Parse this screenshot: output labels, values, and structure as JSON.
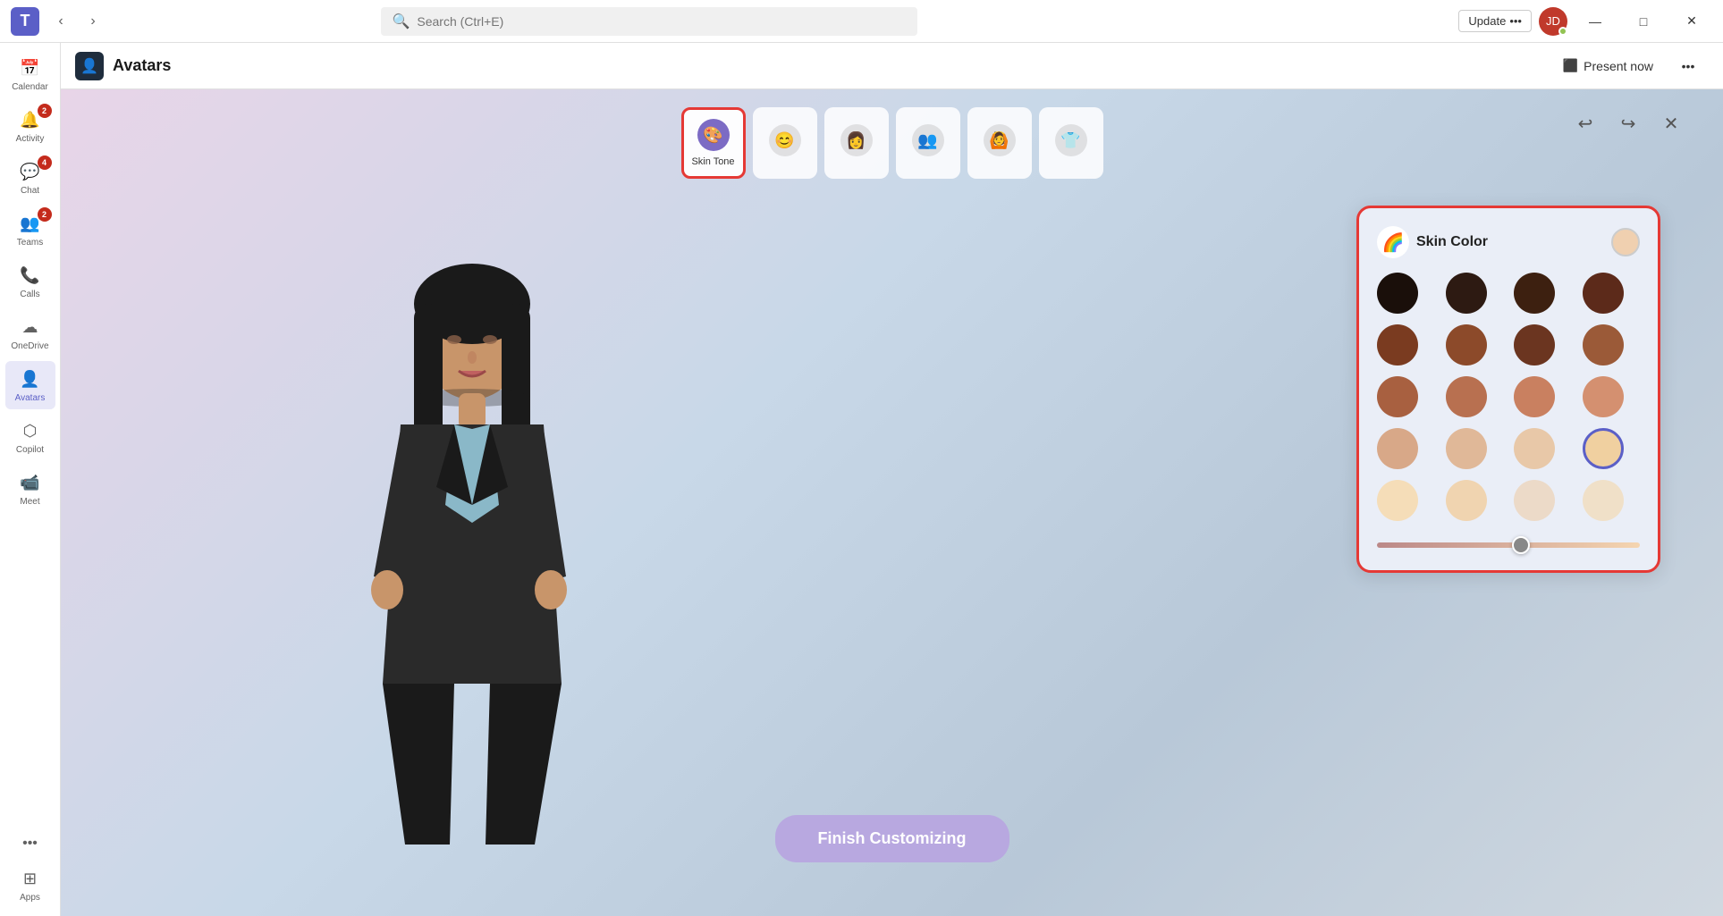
{
  "titlebar": {
    "logo": "T",
    "search_placeholder": "Search (Ctrl+E)",
    "update_label": "Update",
    "update_dots": "•••",
    "minimize": "—",
    "maximize": "□",
    "close": "✕"
  },
  "sidebar": {
    "items": [
      {
        "id": "calendar",
        "label": "Calendar",
        "icon": "📅",
        "badge": null,
        "active": false
      },
      {
        "id": "activity",
        "label": "Activity",
        "icon": "🔔",
        "badge": "2",
        "active": false
      },
      {
        "id": "chat",
        "label": "Chat",
        "icon": "💬",
        "badge": "4",
        "active": false
      },
      {
        "id": "teams",
        "label": "Teams",
        "icon": "👥",
        "badge": "2",
        "active": false
      },
      {
        "id": "calls",
        "label": "Calls",
        "icon": "📞",
        "badge": null,
        "active": false
      },
      {
        "id": "onedrive",
        "label": "OneDrive",
        "icon": "☁",
        "badge": null,
        "active": false
      },
      {
        "id": "avatars",
        "label": "Avatars",
        "icon": "👤",
        "badge": null,
        "active": true
      },
      {
        "id": "copilot",
        "label": "Copilot",
        "icon": "⬡",
        "badge": null,
        "active": false
      },
      {
        "id": "meet",
        "label": "Meet",
        "icon": "📹",
        "badge": null,
        "active": false
      }
    ],
    "more_label": "•••",
    "apps_label": "Apps",
    "apps_icon": "⊞"
  },
  "page": {
    "title": "Avatars",
    "present_now": "Present now",
    "present_icon": "⬛"
  },
  "toolbar": {
    "items": [
      {
        "id": "skin-tone",
        "label": "Skin Tone",
        "icon": "🎨",
        "selected": true
      },
      {
        "id": "face",
        "label": "",
        "icon": "😊",
        "selected": false
      },
      {
        "id": "hair",
        "label": "",
        "icon": "👩",
        "selected": false
      },
      {
        "id": "body",
        "label": "",
        "icon": "👥",
        "selected": false
      },
      {
        "id": "pose",
        "label": "",
        "icon": "🙆",
        "selected": false
      },
      {
        "id": "outfit",
        "label": "",
        "icon": "👕",
        "selected": false
      }
    ],
    "undo_icon": "↩",
    "redo_icon": "↪",
    "close_icon": "✕"
  },
  "skin_panel": {
    "title": "Skin Color",
    "logo_emoji": "🌈",
    "selected_color": "#f0d0b0",
    "swatches": [
      "#1a0f0a",
      "#2d1a12",
      "#3d2010",
      "#5c2a1a",
      "#7a3b20",
      "#8c4a2a",
      "#6b3520",
      "#9b5a38",
      "#a86040",
      "#b87050",
      "#c98060",
      "#d49070",
      "#d8a888",
      "#e0b898",
      "#e8c8a8",
      "#f0d0a0",
      "#f5ddb8",
      "#f0d4b0",
      "#ecdac8",
      "#f0e0c8"
    ],
    "slider_value": 55,
    "slider_min": 0,
    "slider_max": 100
  },
  "finish_btn": {
    "label": "Finish Customizing"
  }
}
